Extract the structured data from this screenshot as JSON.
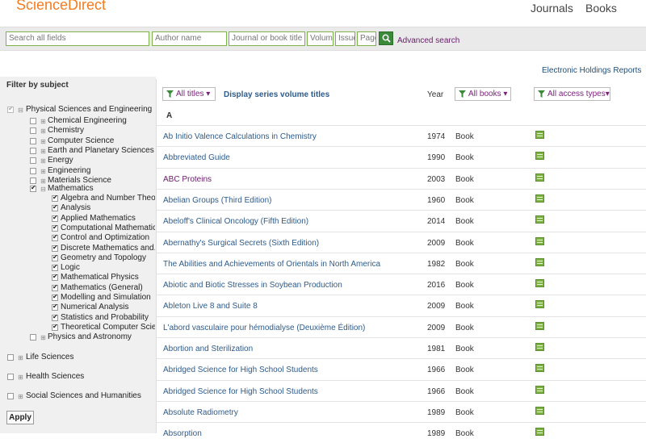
{
  "header": {
    "logo": "ScienceDirect",
    "nav": [
      "Journals",
      "Books"
    ]
  },
  "search": {
    "all_fields": "Search all fields",
    "author": "Author name",
    "journal": "Journal or book title",
    "volume": "Volume",
    "issue": "Issue",
    "page": "Page",
    "advanced": "Advanced search"
  },
  "holdings_link": "Electronic Holdings Reports",
  "sidebar": {
    "title": "Filter by subject",
    "physical": "Physical Sciences and Engineering",
    "physical_children": [
      "Chemical Engineering",
      "Chemistry",
      "Computer Science",
      "Earth and Planetary Sciences",
      "Energy",
      "Engineering",
      "Materials Science"
    ],
    "mathematics": "Mathematics",
    "math_children": [
      "Algebra and Number Theory",
      "Analysis",
      "Applied Mathematics",
      "Computational Mathematics",
      "Control and Optimization",
      "Discrete Mathematics and...",
      "Geometry and Topology",
      "Logic",
      "Mathematical Physics",
      "Mathematics (General)",
      "Modelling and Simulation",
      "Numerical Analysis",
      "Statistics and Probability",
      "Theoretical Computer Scie..."
    ],
    "physics": "Physics and Astronomy",
    "top_others": [
      "Life Sciences",
      "Health Sciences",
      "Social Sciences and Humanities"
    ],
    "apply": "Apply"
  },
  "toolbar": {
    "all_titles": "All titles",
    "display_series": "Display series volume titles",
    "year_header": "Year",
    "all_books": "All books",
    "access": "All access types"
  },
  "letter": "A",
  "rows": [
    {
      "title": "Ab Initio Valence Calculations in Chemistry",
      "year": "1974",
      "kind": "Book",
      "visited": false
    },
    {
      "title": "Abbreviated Guide",
      "year": "1990",
      "kind": "Book",
      "visited": false
    },
    {
      "title": "ABC Proteins",
      "year": "2003",
      "kind": "Book",
      "visited": true
    },
    {
      "title": "Abelian Groups (Third Edition)",
      "year": "1960",
      "kind": "Book",
      "visited": false
    },
    {
      "title": "Abeloff's Clinical Oncology (Fifth Edition)",
      "year": "2014",
      "kind": "Book",
      "visited": false
    },
    {
      "title": "Abernathy's Surgical Secrets (Sixth Edition)",
      "year": "2009",
      "kind": "Book",
      "visited": false
    },
    {
      "title": "The Abilities and Achievements of Orientals in North America",
      "year": "1982",
      "kind": "Book",
      "visited": false
    },
    {
      "title": "Abiotic and Biotic Stresses in Soybean Production",
      "year": "2016",
      "kind": "Book",
      "visited": false
    },
    {
      "title": "Ableton Live 8 and Suite 8",
      "year": "2009",
      "kind": "Book",
      "visited": false
    },
    {
      "title": "L'abord vasculaire pour hémodialyse (Deuxième Édition)",
      "year": "2009",
      "kind": "Book",
      "visited": false
    },
    {
      "title": "Abortion and Sterilization",
      "year": "1981",
      "kind": "Book",
      "visited": false
    },
    {
      "title": "Abridged Science for High School Students",
      "year": "1966",
      "kind": "Book",
      "visited": false
    },
    {
      "title": "Abridged Science for High School Students",
      "year": "1966",
      "kind": "Book",
      "visited": false
    },
    {
      "title": "Absolute Radiometry",
      "year": "1989",
      "kind": "Book",
      "visited": false
    },
    {
      "title": "Absorption",
      "year": "1989",
      "kind": "Book",
      "visited": false
    }
  ]
}
